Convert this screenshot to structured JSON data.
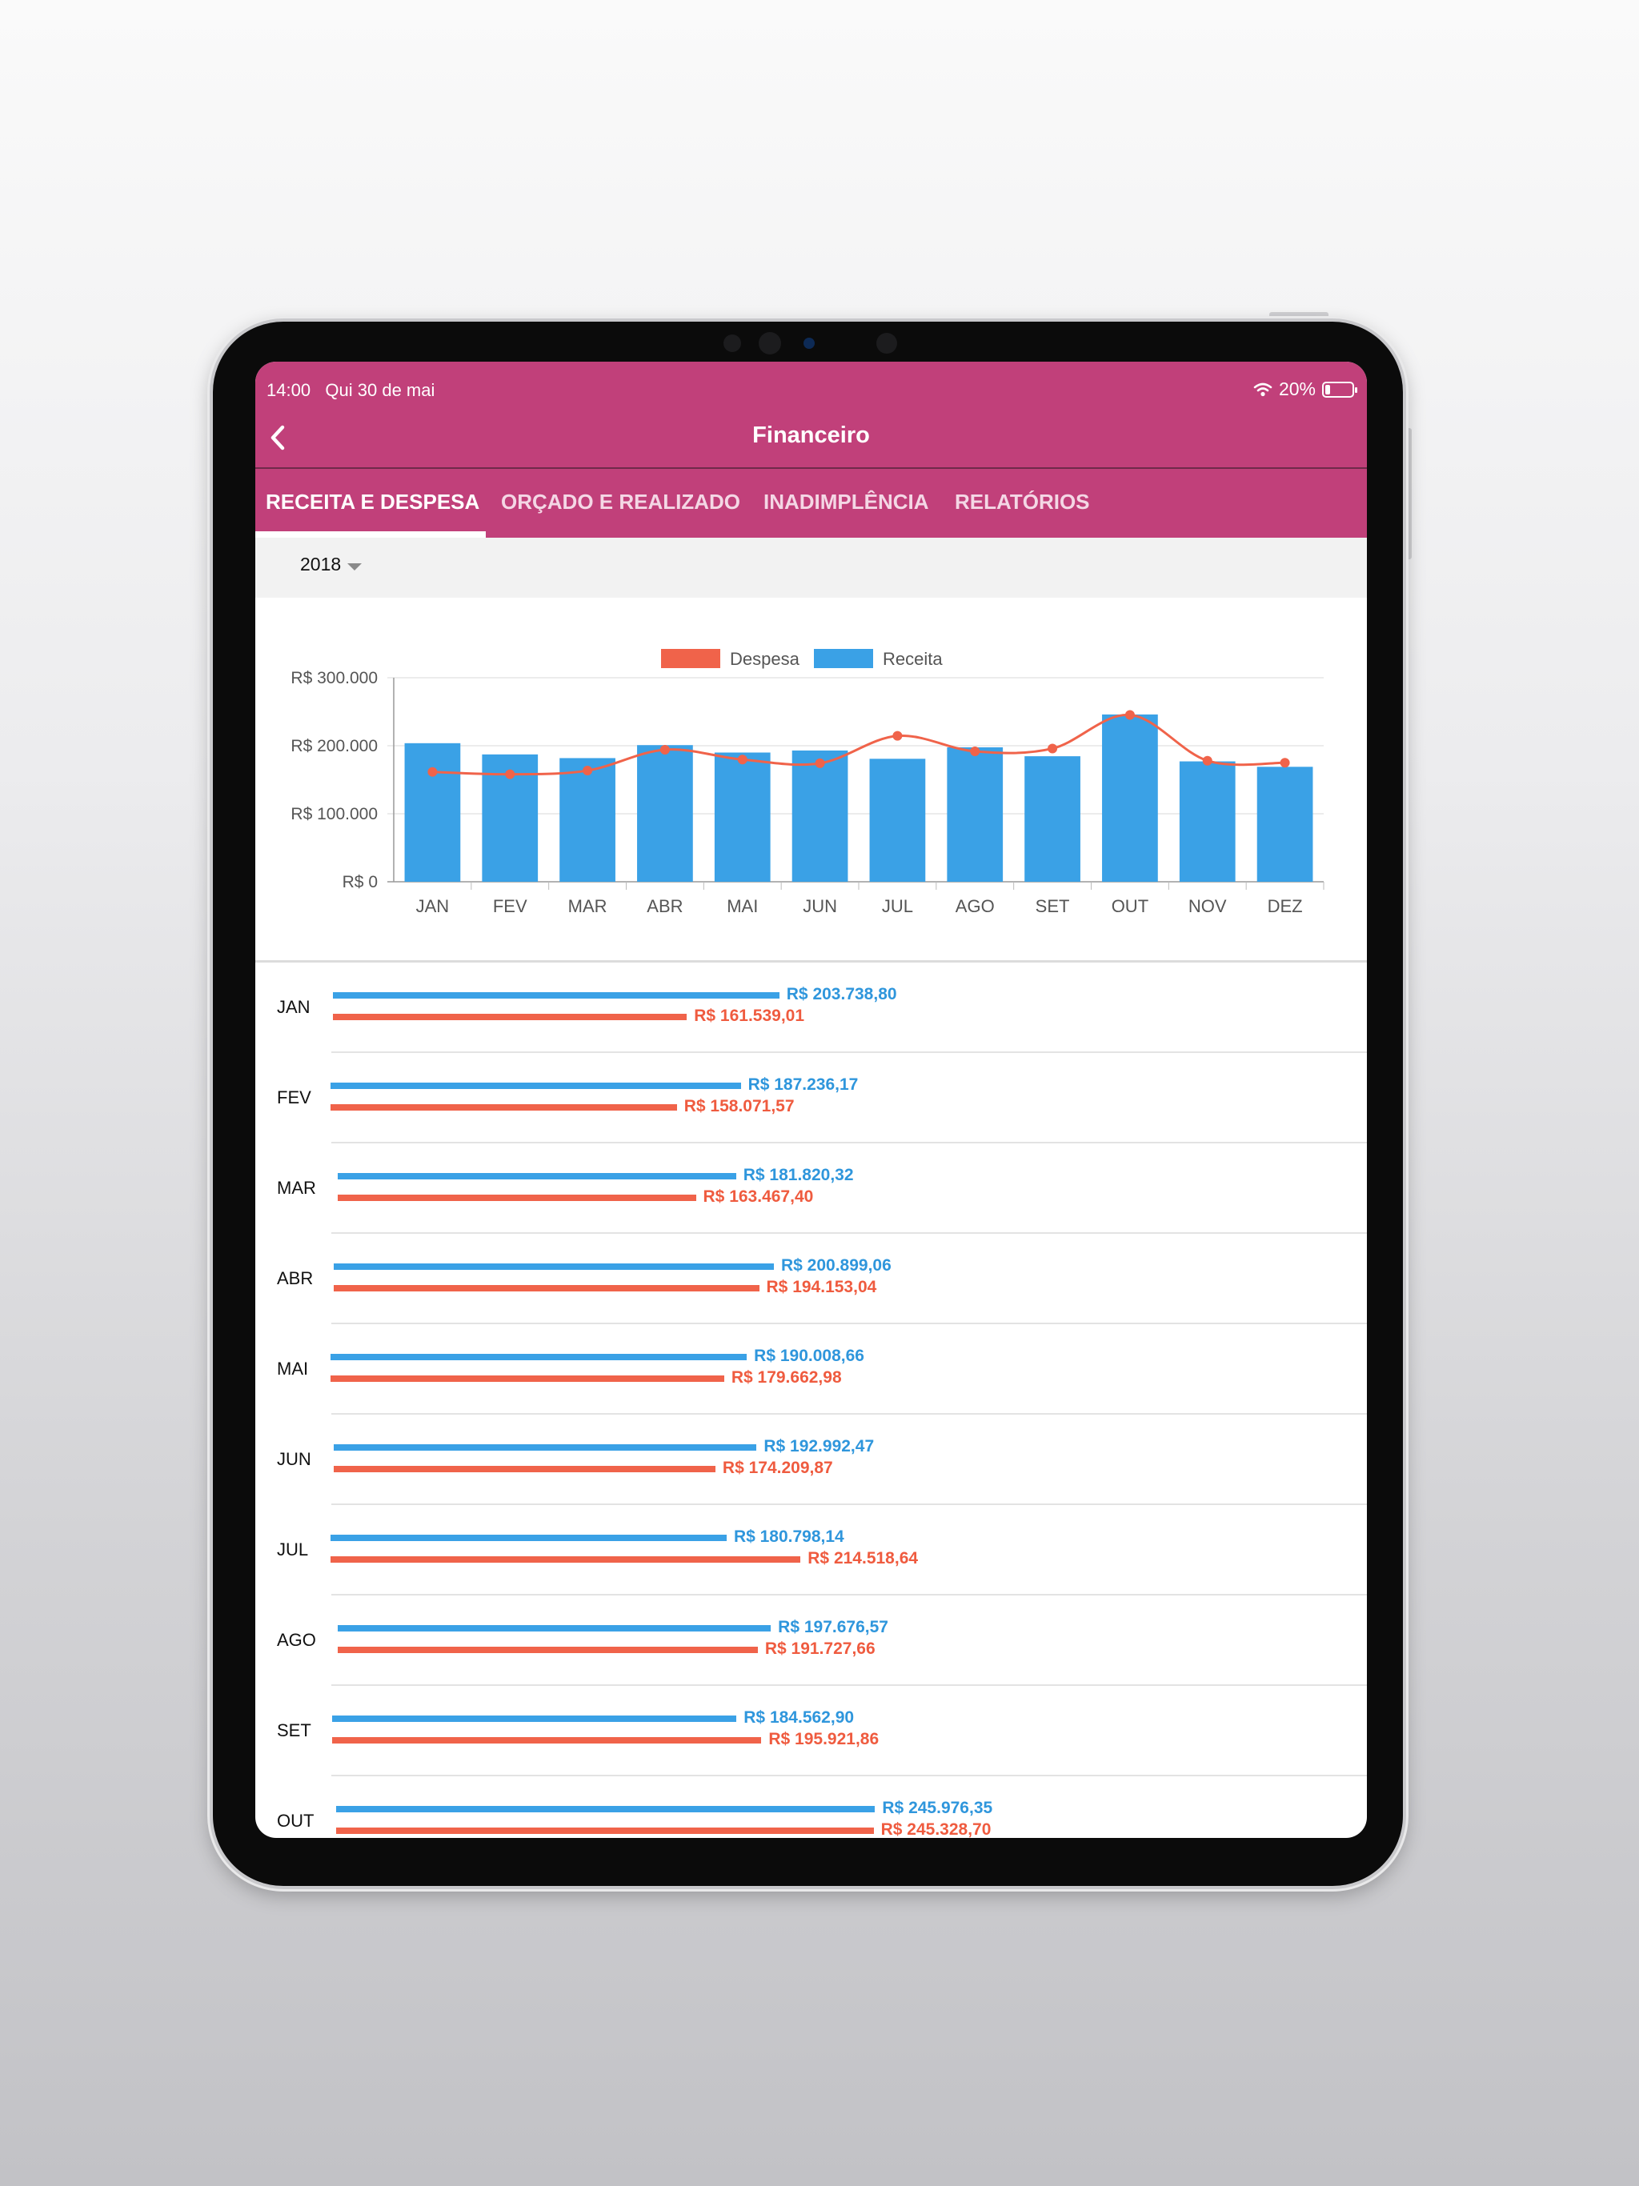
{
  "status": {
    "time": "14:00",
    "date": "Qui 30 de mai",
    "battery": "20%",
    "battery_level": 0.2
  },
  "header": {
    "title": "Financeiro",
    "back_icon": "chevron-left-icon"
  },
  "tabs": [
    {
      "label": "RECEITA E DESPESA",
      "active": true
    },
    {
      "label": "ORÇADO E REALIZADO",
      "active": false
    },
    {
      "label": "INADIMPLÊNCIA",
      "active": false
    },
    {
      "label": "RELATÓRIOS",
      "active": false
    }
  ],
  "filter": {
    "year": "2018"
  },
  "colors": {
    "primary": "#c1407a",
    "receita": "#3aa1e6",
    "despesa": "#f0634a"
  },
  "chart_data": {
    "type": "bar",
    "categories": [
      "JAN",
      "FEV",
      "MAR",
      "ABR",
      "MAI",
      "JUN",
      "JUL",
      "AGO",
      "SET",
      "OUT",
      "NOV",
      "DEZ"
    ],
    "series": [
      {
        "name": "Receita",
        "type": "bar",
        "values": [
          203738.8,
          187236.17,
          181820.32,
          200899.06,
          190008.66,
          192992.47,
          180798.14,
          197676.57,
          184562.9,
          245976.35,
          177000,
          169000
        ]
      },
      {
        "name": "Despesa",
        "type": "line",
        "values": [
          161539.01,
          158071.57,
          163467.4,
          194153.04,
          179662.98,
          174209.87,
          214518.64,
          191727.66,
          195921.86,
          245328.7,
          178000,
          175000
        ]
      }
    ],
    "yticks": [
      "R$ 0",
      "R$ 100.000",
      "R$ 200.000",
      "R$ 300.000"
    ],
    "ylim": [
      0,
      300000
    ],
    "legend": [
      {
        "label": "Despesa"
      },
      {
        "label": "Receita"
      }
    ],
    "legend_position": "top-center",
    "grid": true
  },
  "rows": [
    {
      "month": "JAN",
      "receita": "R$ 203.738,80",
      "despesa": "R$ 161.539,01",
      "receita_value": 203738.8,
      "despesa_value": 161539.01
    },
    {
      "month": "FEV",
      "receita": "R$ 187.236,17",
      "despesa": "R$ 158.071,57",
      "receita_value": 187236.17,
      "despesa_value": 158071.57
    },
    {
      "month": "MAR",
      "receita": "R$ 181.820,32",
      "despesa": "R$ 163.467,40",
      "receita_value": 181820.32,
      "despesa_value": 163467.4
    },
    {
      "month": "ABR",
      "receita": "R$ 200.899,06",
      "despesa": "R$ 194.153,04",
      "receita_value": 200899.06,
      "despesa_value": 194153.04
    },
    {
      "month": "MAI",
      "receita": "R$ 190.008,66",
      "despesa": "R$ 179.662,98",
      "receita_value": 190008.66,
      "despesa_value": 179662.98
    },
    {
      "month": "JUN",
      "receita": "R$ 192.992,47",
      "despesa": "R$ 174.209,87",
      "receita_value": 192992.47,
      "despesa_value": 174209.87
    },
    {
      "month": "JUL",
      "receita": "R$ 180.798,14",
      "despesa": "R$ 214.518,64",
      "receita_value": 180798.14,
      "despesa_value": 214518.64
    },
    {
      "month": "AGO",
      "receita": "R$ 197.676,57",
      "despesa": "R$ 191.727,66",
      "receita_value": 197676.57,
      "despesa_value": 191727.66
    },
    {
      "month": "SET",
      "receita": "R$ 184.562,90",
      "despesa": "R$ 195.921,86",
      "receita_value": 184562.9,
      "despesa_value": 195921.86
    },
    {
      "month": "OUT",
      "receita": "R$ 245.976,35",
      "despesa": "R$ 245.328,70",
      "receita_value": 245976.35,
      "despesa_value": 245328.7
    }
  ]
}
